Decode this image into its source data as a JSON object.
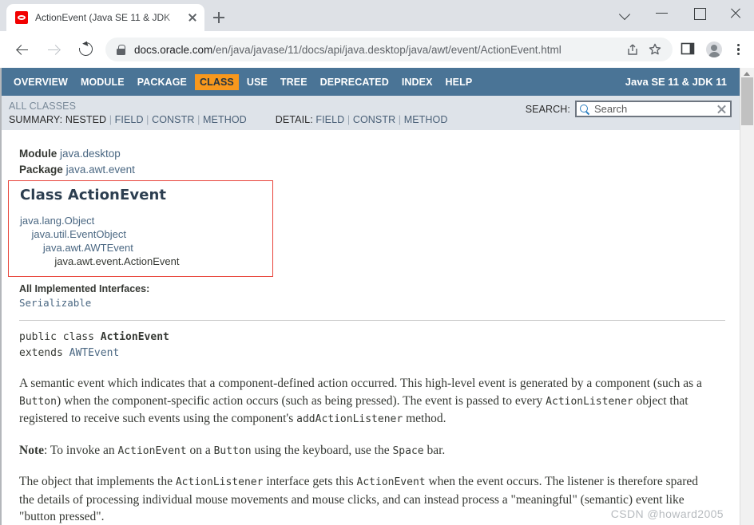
{
  "browser": {
    "tab": {
      "title": "ActionEvent (Java SE 11 & JDK",
      "favicon": "oracle-favicon",
      "close_icon": "close-icon"
    },
    "new_tab_label": "+",
    "window_controls": [
      {
        "name": "tab-search-button",
        "icon": "chevron-down-icon"
      },
      {
        "name": "minimize-button",
        "icon": "minimize-icon"
      },
      {
        "name": "maximize-button",
        "icon": "maximize-icon"
      },
      {
        "name": "close-window-button",
        "icon": "close-icon"
      }
    ],
    "toolbar": {
      "back_icon": "arrow-left-icon",
      "forward_icon": "arrow-right-icon",
      "reload_icon": "reload-icon",
      "lock_icon": "lock-icon",
      "url_domain": "docs.oracle.com",
      "url_path": "/en/java/javase/11/docs/api/java.desktop/java/awt/event/ActionEvent.html",
      "url_full": "docs.oracle.com/en/java/javase/11/docs/api/java.desktop/java/awt/event/ActionEvent.html",
      "share_icon": "share-icon",
      "bookmark_icon": "star-icon",
      "sidepanel_icon": "side-panel-icon",
      "profile_icon": "avatar-icon",
      "menu_icon": "three-dot-menu-icon"
    }
  },
  "page": {
    "topnav": {
      "items": [
        {
          "label": "OVERVIEW",
          "active": false
        },
        {
          "label": "MODULE",
          "active": false
        },
        {
          "label": "PACKAGE",
          "active": false
        },
        {
          "label": "CLASS",
          "active": true
        },
        {
          "label": "USE",
          "active": false
        },
        {
          "label": "TREE",
          "active": false
        },
        {
          "label": "DEPRECATED",
          "active": false
        },
        {
          "label": "INDEX",
          "active": false
        },
        {
          "label": "HELP",
          "active": false
        }
      ],
      "product": "Java SE 11 & JDK 11",
      "accent_bg": "#4a7496",
      "active_bg": "#f8981d"
    },
    "subnav": {
      "all_classes": "ALL CLASSES",
      "summary_label": "SUMMARY:",
      "summary_current": "NESTED",
      "summary_links": [
        "FIELD",
        "CONSTR",
        "METHOD"
      ],
      "detail_label": "DETAIL:",
      "detail_links": [
        "FIELD",
        "CONSTR",
        "METHOD"
      ],
      "search_label": "SEARCH:",
      "search_placeholder": "Search",
      "search_value": "",
      "search_icon": "magnifier-icon",
      "search_clear_icon": "clear-x-icon"
    },
    "header": {
      "module_label": "Module",
      "module_value": "java.desktop",
      "package_label": "Package",
      "package_value": "java.awt.event",
      "class_title": "Class ActionEvent",
      "hierarchy": [
        "java.lang.Object",
        "    java.util.EventObject",
        "        java.awt.AWTEvent",
        "            java.awt.event.ActionEvent"
      ],
      "annotation_box_color": "#e8443a"
    },
    "interfaces": {
      "label": "All Implemented Interfaces:",
      "values": "Serializable"
    },
    "signature": {
      "line1_prefix": "public class ",
      "line1_name": "ActionEvent",
      "line2_prefix": "extends ",
      "line2_name": "AWTEvent"
    },
    "paragraphs": [
      {
        "id": "description",
        "parts": [
          {
            "t": "A semantic event which indicates that a component-defined action occurred. This high-level event is generated by a component (such as a ",
            "k": "text"
          },
          {
            "t": "Button",
            "k": "code"
          },
          {
            "t": ") when the component-specific action occurs (such as being pressed). The event is passed to every ",
            "k": "text"
          },
          {
            "t": "ActionListener",
            "k": "code"
          },
          {
            "t": " object that registered to receive such events using the component's ",
            "k": "text"
          },
          {
            "t": "addActionListener",
            "k": "code"
          },
          {
            "t": " method.",
            "k": "text"
          }
        ]
      },
      {
        "id": "note",
        "parts": [
          {
            "t": "Note",
            "k": "bold"
          },
          {
            "t": ": To invoke an ",
            "k": "text"
          },
          {
            "t": "ActionEvent",
            "k": "code"
          },
          {
            "t": " on a ",
            "k": "text"
          },
          {
            "t": "Button",
            "k": "code"
          },
          {
            "t": " using the keyboard, use the ",
            "k": "text"
          },
          {
            "t": "Space",
            "k": "code"
          },
          {
            "t": " bar.",
            "k": "text"
          }
        ]
      },
      {
        "id": "listener",
        "parts": [
          {
            "t": "The object that implements the ",
            "k": "text"
          },
          {
            "t": "ActionListener",
            "k": "code"
          },
          {
            "t": " interface gets this ",
            "k": "text"
          },
          {
            "t": "ActionEvent",
            "k": "code"
          },
          {
            "t": " when the event occurs. The listener is therefore spared the details of processing individual mouse movements and mouse clicks, and can instead process a \"meaningful\" (semantic) event like \"button pressed\".",
            "k": "text"
          }
        ]
      }
    ],
    "watermark": "CSDN @howard2005"
  }
}
